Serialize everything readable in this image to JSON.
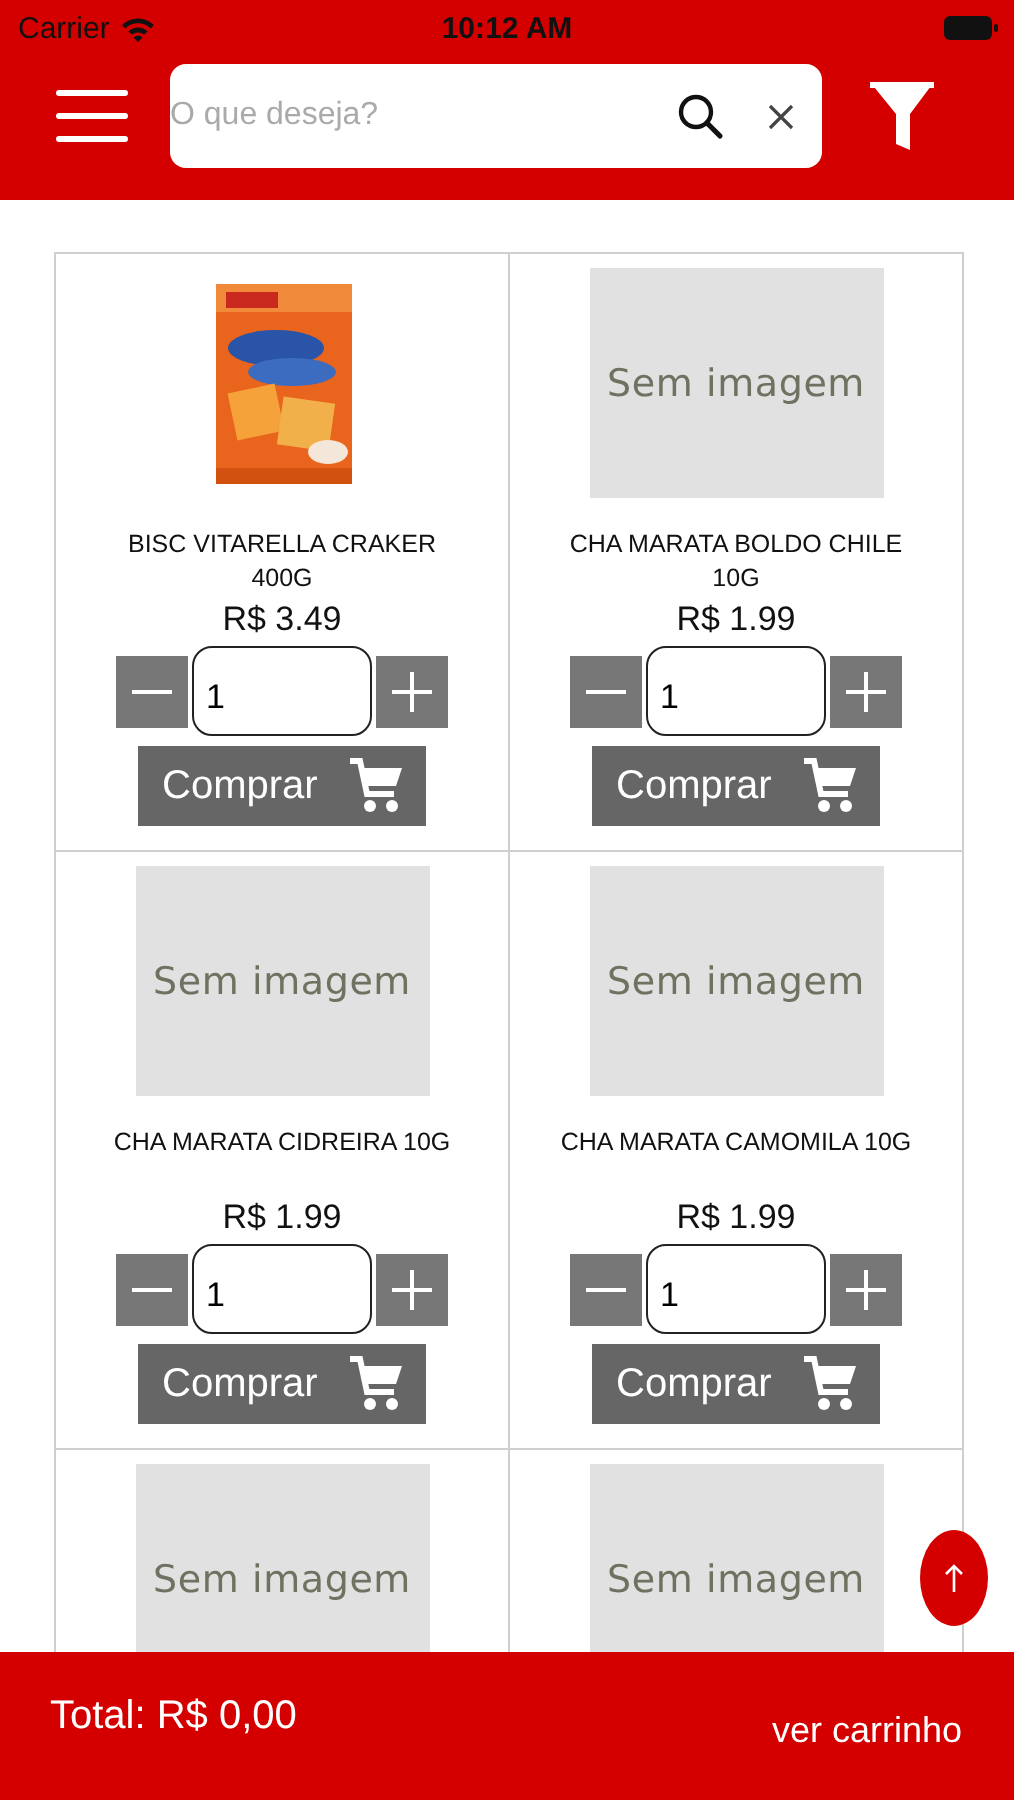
{
  "status_bar": {
    "carrier": "Carrier",
    "time": "10:12 AM"
  },
  "search": {
    "placeholder": "O que deseja?"
  },
  "product_rows": [
    {
      "products": [
        {
          "name": "BISC VITARELLA CRAKER 400G",
          "price": "R$ 3.49",
          "quantity": "1",
          "buy_label": "Comprar"
        },
        {
          "kind": "placeholder",
          "placeholder_text": "Sem imagem",
          "name": "CHA MARATA BOLDO CHILE 10G",
          "price": "R$ 1.99",
          "quantity": "1",
          "buy_label": "Comprar"
        }
      ]
    },
    {
      "products": [
        {
          "kind": "placeholder",
          "placeholder_text": "Sem imagem",
          "name": "CHA MARATA CIDREIRA 10G",
          "price": "R$ 1.99",
          "quantity": "1",
          "buy_label": "Comprar"
        },
        {
          "kind": "placeholder",
          "placeholder_text": "Sem imagem",
          "name": "CHA MARATA CAMOMILA 10G",
          "price": "R$ 1.99",
          "quantity": "1",
          "buy_label": "Comprar"
        }
      ]
    },
    {
      "products": [
        {
          "kind": "placeholder",
          "placeholder_text": "Sem imagem"
        },
        {
          "kind": "placeholder",
          "placeholder_text": "Sem imagem"
        }
      ]
    }
  ],
  "cart_bar": {
    "total": "Total: R$ 0,00",
    "link": "ver carrinho"
  }
}
